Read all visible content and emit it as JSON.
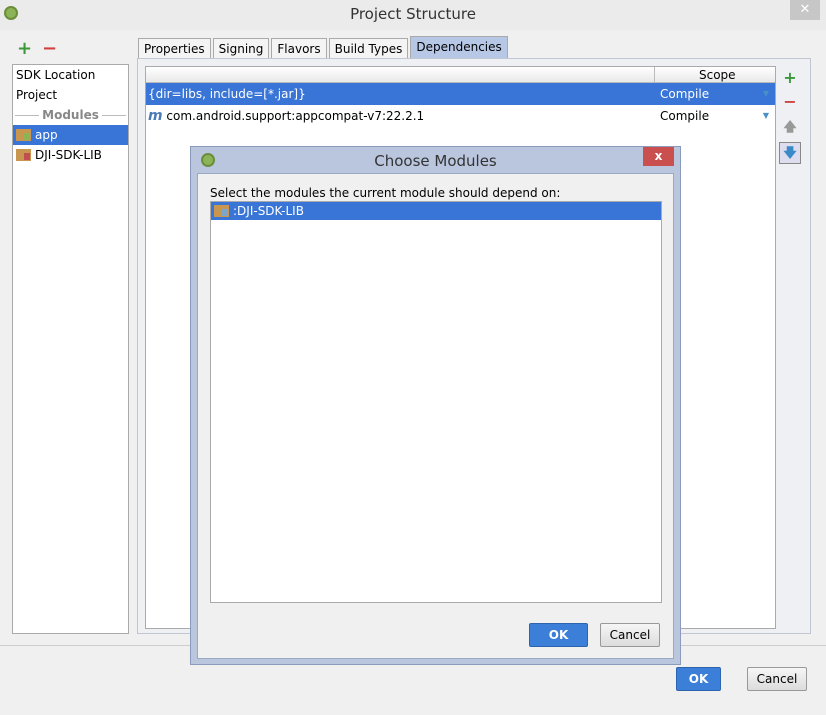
{
  "window": {
    "title": "Project Structure",
    "close_label": "✕"
  },
  "left": {
    "add_label": "+",
    "remove_label": "−",
    "items": [
      "SDK Location",
      "Project"
    ],
    "modules_header": "Modules",
    "modules": [
      "app",
      "DJI-SDK-LIB"
    ],
    "selected_module": "app"
  },
  "tabs": [
    "Properties",
    "Signing",
    "Flavors",
    "Build Types",
    "Dependencies"
  ],
  "active_tab": "Dependencies",
  "dependencies": {
    "scope_header": "Scope",
    "rows": [
      {
        "name": "{dir=libs, include=[*.jar]}",
        "scope": "Compile",
        "selected": true
      },
      {
        "icon": "m",
        "name": "com.android.support:appcompat-v7:22.2.1",
        "scope": "Compile",
        "selected": false
      }
    ],
    "side_buttons": {
      "add": "+",
      "remove": "−",
      "up": "🡅",
      "down": "🡇"
    }
  },
  "footer": {
    "ok": "OK",
    "cancel": "Cancel"
  },
  "dialog": {
    "title": "Choose Modules",
    "close": "x",
    "prompt": "Select the modules the current module should depend on:",
    "items": [
      ":DJI-SDK-LIB"
    ],
    "ok": "OK",
    "cancel": "Cancel"
  },
  "colors": {
    "selection": "#3875d7",
    "accent_ok": "#3b7fd8",
    "add": "#3a9a3a",
    "remove": "#d04040",
    "dialog_title": "#b9c6de"
  }
}
